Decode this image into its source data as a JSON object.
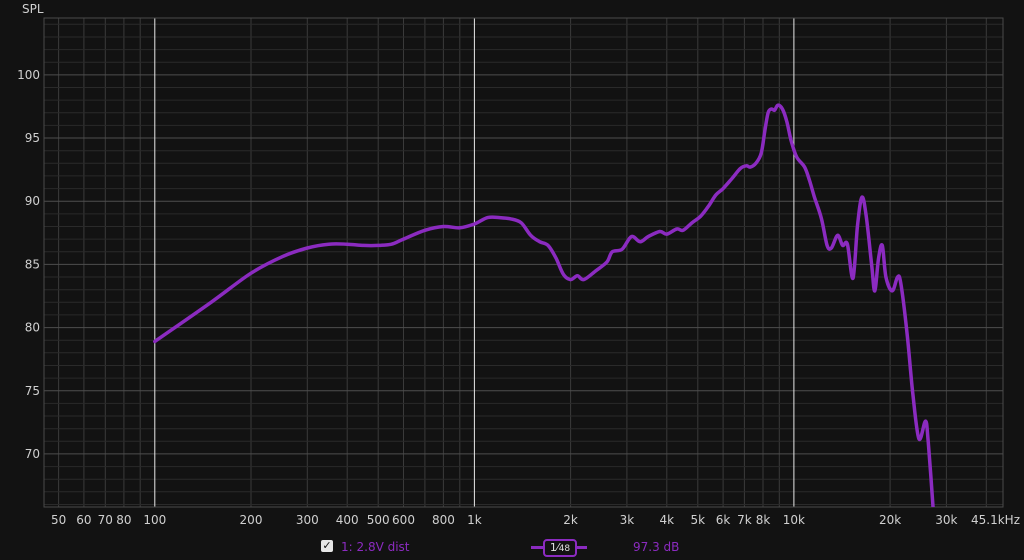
{
  "colors": {
    "series": "#8b2bc0",
    "grid_major": "#e8e8e8",
    "grid_minor": "#3a3a3a",
    "background": "#121212"
  },
  "chart_data": {
    "type": "line",
    "ylabel": "SPL",
    "x_scale": "log",
    "xlim": [
      45,
      45100
    ],
    "ylim": [
      65.8,
      104.5
    ],
    "yticks": [
      70,
      75,
      80,
      85,
      90,
      95,
      100
    ],
    "xticks": [
      {
        "v": 50,
        "label": "50"
      },
      {
        "v": 60,
        "label": "60"
      },
      {
        "v": 70,
        "label": "70"
      },
      {
        "v": 80,
        "label": "80"
      },
      {
        "v": 100,
        "label": "100"
      },
      {
        "v": 200,
        "label": "200"
      },
      {
        "v": 300,
        "label": "300"
      },
      {
        "v": 400,
        "label": "400"
      },
      {
        "v": 500,
        "label": "500"
      },
      {
        "v": 600,
        "label": "600"
      },
      {
        "v": 800,
        "label": "800"
      },
      {
        "v": 1000,
        "label": "1k"
      },
      {
        "v": 2000,
        "label": "2k"
      },
      {
        "v": 3000,
        "label": "3k"
      },
      {
        "v": 4000,
        "label": "4k"
      },
      {
        "v": 5000,
        "label": "5k"
      },
      {
        "v": 6000,
        "label": "6k"
      },
      {
        "v": 7000,
        "label": "7k"
      },
      {
        "v": 8000,
        "label": "8k"
      },
      {
        "v": 10000,
        "label": "10k"
      },
      {
        "v": 20000,
        "label": "20k"
      },
      {
        "v": 30000,
        "label": "30k"
      },
      {
        "v": 45100,
        "label": "45.1kHz"
      }
    ],
    "grid": true,
    "series": [
      {
        "name": "1: 2.8V dist",
        "points": [
          [
            100,
            78.9
          ],
          [
            150,
            82.0
          ],
          [
            200,
            84.3
          ],
          [
            250,
            85.6
          ],
          [
            300,
            86.3
          ],
          [
            350,
            86.6
          ],
          [
            400,
            86.6
          ],
          [
            450,
            86.5
          ],
          [
            500,
            86.5
          ],
          [
            550,
            86.6
          ],
          [
            600,
            87.0
          ],
          [
            700,
            87.7
          ],
          [
            800,
            88.0
          ],
          [
            900,
            87.9
          ],
          [
            1000,
            88.2
          ],
          [
            1100,
            88.7
          ],
          [
            1200,
            88.7
          ],
          [
            1300,
            88.6
          ],
          [
            1400,
            88.3
          ],
          [
            1500,
            87.3
          ],
          [
            1600,
            86.8
          ],
          [
            1700,
            86.5
          ],
          [
            1800,
            85.5
          ],
          [
            1900,
            84.2
          ],
          [
            2000,
            83.8
          ],
          [
            2100,
            84.1
          ],
          [
            2200,
            83.8
          ],
          [
            2400,
            84.5
          ],
          [
            2600,
            85.2
          ],
          [
            2700,
            86.0
          ],
          [
            2900,
            86.2
          ],
          [
            3100,
            87.2
          ],
          [
            3300,
            86.8
          ],
          [
            3500,
            87.2
          ],
          [
            3800,
            87.6
          ],
          [
            4000,
            87.4
          ],
          [
            4300,
            87.8
          ],
          [
            4500,
            87.7
          ],
          [
            4800,
            88.3
          ],
          [
            5100,
            88.8
          ],
          [
            5400,
            89.6
          ],
          [
            5700,
            90.5
          ],
          [
            6000,
            91.0
          ],
          [
            6400,
            91.8
          ],
          [
            6800,
            92.6
          ],
          [
            7100,
            92.8
          ],
          [
            7300,
            92.7
          ],
          [
            7600,
            93.0
          ],
          [
            7900,
            93.8
          ],
          [
            8100,
            95.5
          ],
          [
            8300,
            97.0
          ],
          [
            8500,
            97.3
          ],
          [
            8700,
            97.2
          ],
          [
            8900,
            97.6
          ],
          [
            9200,
            97.3
          ],
          [
            9500,
            96.3
          ],
          [
            9800,
            94.8
          ],
          [
            10200,
            93.5
          ],
          [
            10800,
            92.7
          ],
          [
            11200,
            91.6
          ],
          [
            11600,
            90.3
          ],
          [
            12200,
            88.6
          ],
          [
            12700,
            86.5
          ],
          [
            13100,
            86.3
          ],
          [
            13700,
            87.3
          ],
          [
            14200,
            86.5
          ],
          [
            14700,
            86.6
          ],
          [
            15300,
            83.9
          ],
          [
            15800,
            88.0
          ],
          [
            16300,
            90.3
          ],
          [
            16800,
            89.0
          ],
          [
            17500,
            85.0
          ],
          [
            17900,
            82.9
          ],
          [
            18400,
            85.5
          ],
          [
            18900,
            86.5
          ],
          [
            19400,
            84.0
          ],
          [
            20300,
            82.9
          ],
          [
            21100,
            84.0
          ],
          [
            21600,
            83.5
          ],
          [
            22600,
            79.5
          ],
          [
            23500,
            75.0
          ],
          [
            24600,
            71.2
          ],
          [
            25800,
            72.6
          ],
          [
            26300,
            71.0
          ],
          [
            27300,
            65.5
          ]
        ]
      }
    ]
  },
  "legend": {
    "checkbox": "✓",
    "series_label": "1: 2.8V dist",
    "smoothing_num": "1",
    "smoothing_den": "48",
    "value": "97.3 dB"
  }
}
